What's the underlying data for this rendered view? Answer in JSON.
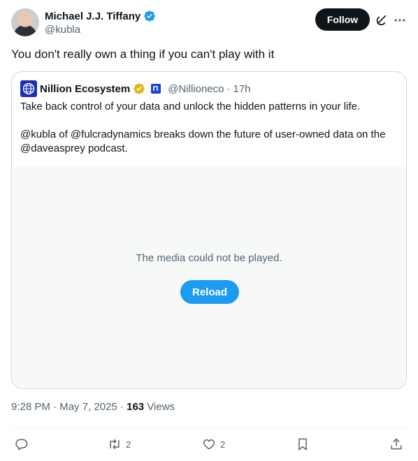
{
  "author": {
    "name": "Michael J.J. Tiffany",
    "handle": "@kubla"
  },
  "follow_label": "Follow",
  "tweet_text": "You don't really own a thing if you can't play with it",
  "quote": {
    "name": "Nillion Ecosystem",
    "handle": "@Nillioneco",
    "separator": "·",
    "time": "17h",
    "paragraphs": [
      "Take back control of your data and unlock the hidden patterns in your life.",
      "@kubla of @fulcradynamics breaks down the future of user-owned data on the @daveasprey podcast."
    ],
    "media_message": "The media could not be played.",
    "reload_label": "Reload"
  },
  "meta": {
    "time": "9:28 PM",
    "dot1": "·",
    "date": "May 7, 2025",
    "dot2": "·",
    "views_count": "163",
    "views_label": "Views"
  },
  "actions": {
    "retweets": "2",
    "likes": "2"
  },
  "colors": {
    "verified_blue": "#1d9bf0",
    "gold": "#e2b719",
    "text": "#0f1419",
    "secondary": "#536471"
  },
  "icons": [
    "verified-icon",
    "grok-icon",
    "more-icon",
    "reply-icon",
    "retweet-icon",
    "like-icon",
    "bookmark-icon",
    "share-icon"
  ]
}
